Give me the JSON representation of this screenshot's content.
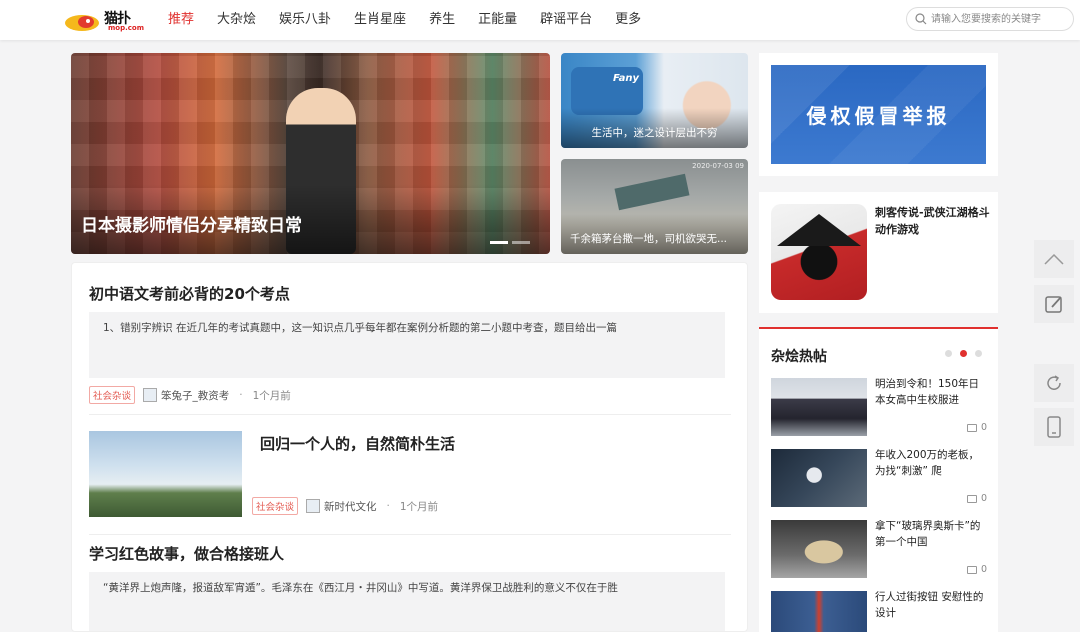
{
  "header": {
    "logo_text": "猫扑",
    "logo_sub": "mop.com",
    "nav": [
      "推荐",
      "大杂烩",
      "娱乐八卦",
      "生肖星座",
      "养生",
      "正能量",
      "辟谣平台",
      "更多"
    ],
    "search_placeholder": "请输入您要搜索的关键字"
  },
  "hero": {
    "title": "日本摄影师情侣分享精致日常"
  },
  "side_cards": [
    {
      "title": "生活中，迷之设计层出不穷",
      "label": "Fany"
    },
    {
      "title": "千余箱茅台撒一地，司机欲哭无...",
      "stamp": "2020-07-03 09"
    }
  ],
  "articles": [
    {
      "title": "初中语文考前必背的20个考点",
      "excerpt": "1、错别字辨识 在近几年的考试真题中，这一知识点几乎每年都在案例分析题的第二小题中考查，题目给出一篇",
      "tag": "社会杂谈",
      "author": "笨兔子_教资考",
      "time": "1个月前"
    },
    {
      "title": "回归一个人的，自然简朴生活",
      "tag": "社会杂谈",
      "author": "新时代文化",
      "time": "1个月前"
    },
    {
      "title": "学习红色故事，做合格接班人",
      "excerpt": "“黄洋界上炮声隆，报道敌军宵遁”。毛泽东在《西江月・井冈山》中写道。黄洋界保卫战胜利的意义不仅在于胜"
    }
  ],
  "sidebar": {
    "ad_text": "侵权假冒举报",
    "game_name": "刺客传说-武侠江湖格斗动作游戏",
    "hot_title": "杂烩热帖",
    "hot_posts": [
      {
        "title": "明治到令和！150年日本女高中生校服进",
        "comments": "0"
      },
      {
        "title": "年收入200万的老板，为找“刺激” 爬",
        "comments": "0"
      },
      {
        "title": "拿下“玻璃界奥斯卡”的第一个中国",
        "comments": "0"
      },
      {
        "title": "行人过街按钮 安慰性的设计",
        "comments": ""
      }
    ]
  },
  "icons": {
    "search": "search-icon",
    "back_to_top": "chevron-up-icon",
    "edit": "edit-icon",
    "refresh": "refresh-icon",
    "mobile": "mobile-icon",
    "comment": "comment-icon"
  },
  "colors": {
    "accent": "#e0302e",
    "tag_border": "#f2a9a4",
    "ad_blue": "#2a68c2"
  }
}
